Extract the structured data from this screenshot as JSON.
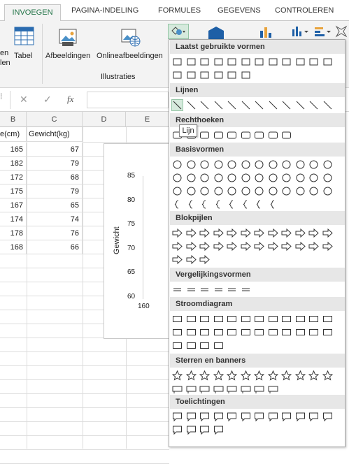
{
  "tabs": {
    "active": "INVOEGEN",
    "items": [
      "PAGINA-INDELING",
      "FORMULES",
      "GEGEVENS",
      "CONTROLEREN"
    ]
  },
  "ribbon": {
    "left_cut_1": "en",
    "left_cut_2": "len",
    "tabel": "Tabel",
    "afbeeldingen": "Afbeeldingen",
    "online": "Onlineafbeeldingen",
    "group": "Illustraties"
  },
  "formula": {
    "cancel": "✕",
    "confirm": "✓",
    "fx": "fx"
  },
  "grid": {
    "cols": [
      "B",
      "C",
      "D",
      "E"
    ],
    "header_b": "e(cm)",
    "header_c": "Gewicht(kg)",
    "b": [
      "165",
      "182",
      "172",
      "175",
      "167",
      "174",
      "178",
      "168"
    ],
    "c": [
      "67",
      "79",
      "68",
      "79",
      "65",
      "74",
      "76",
      "66"
    ]
  },
  "chart": {
    "ylabel": "Gewicht",
    "yticks": [
      "85",
      "80",
      "75",
      "70",
      "65",
      "60"
    ],
    "xtick": "160"
  },
  "panel": {
    "sections": [
      "Laatst gebruikte vormen",
      "Lijnen",
      "Rechthoeken",
      "Basisvormen",
      "Blokpijlen",
      "Vergelijkingsvormen",
      "Stroomdiagram",
      "Sterren en banners",
      "Toelichtingen"
    ],
    "tooltip": "Lijn"
  },
  "colors": {
    "accent": "#217346",
    "highlight": "#d6eadd"
  }
}
